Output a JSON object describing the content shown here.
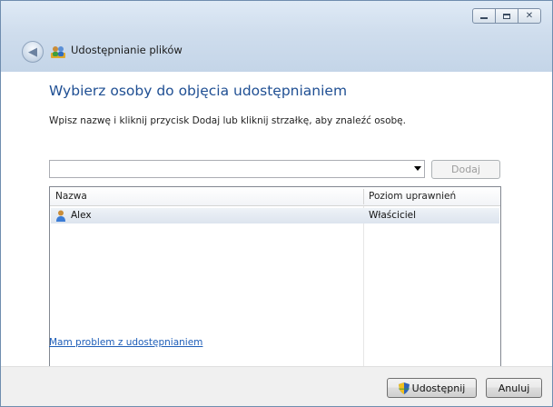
{
  "window": {
    "title": "Udostępnianie plików"
  },
  "main": {
    "heading": "Wybierz osoby do objęcia udostępnianiem",
    "instruction": "Wpisz nazwę i kliknij przycisk Dodaj lub kliknij strzałkę, aby znaleźć osobę.",
    "combo_value": "",
    "add_label": "Dodaj",
    "columns": [
      "Nazwa",
      "Poziom uprawnień"
    ],
    "rows": [
      {
        "name": "Alex",
        "permission": "Właściciel",
        "icon": "user-icon"
      }
    ],
    "help_link": "Mam problem z udostępnianiem"
  },
  "footer": {
    "share_label": "Udostępnij",
    "cancel_label": "Anuluj"
  },
  "colors": {
    "heading": "#1f4f93",
    "link": "#1e5eb8",
    "selected_row": "#dde4ee"
  }
}
